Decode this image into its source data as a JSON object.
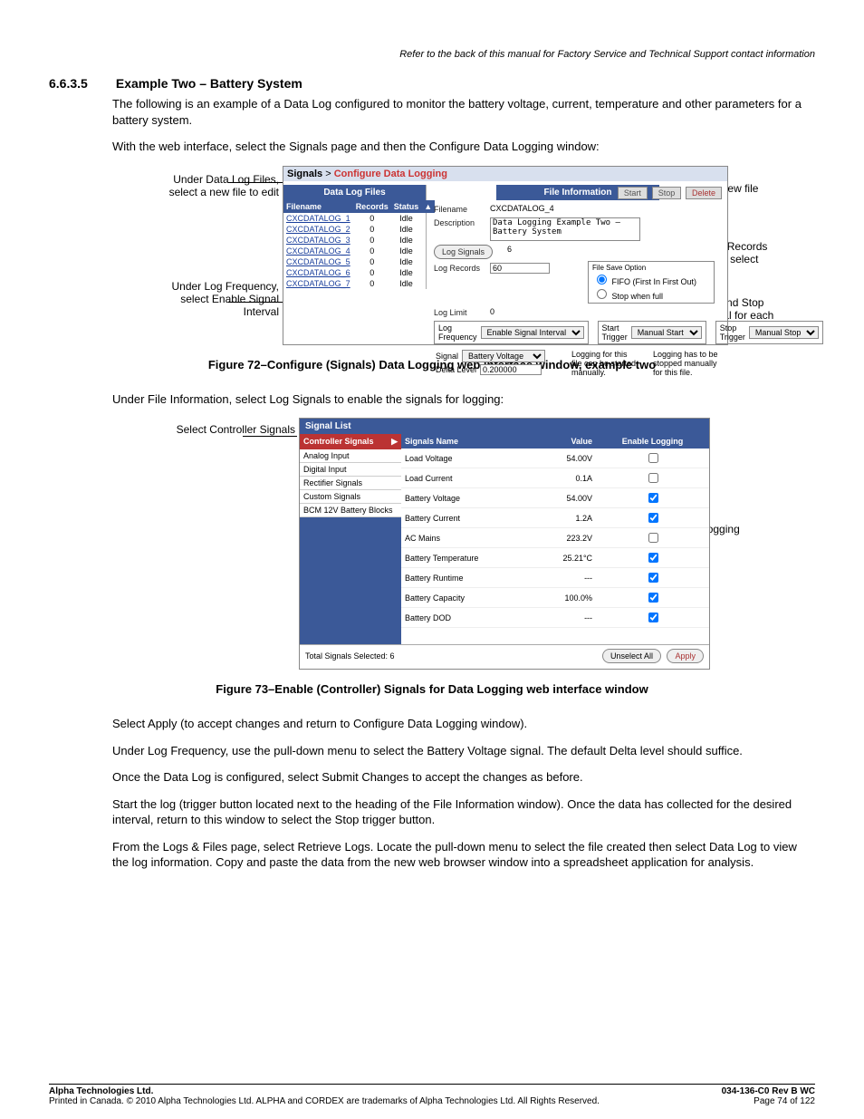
{
  "top_note": "Refer to the back of this manual for Factory Service and Technical Support contact information",
  "section": {
    "num": "6.6.3.5",
    "title": "Example Two – Battery System"
  },
  "intro1": "The following is an example of a Data Log configured to monitor the battery voltage, current, temperature and other parameters for a battery system.",
  "intro2": "With the web interface, select the Signals page and then the Configure Data Logging window:",
  "fig72": {
    "left1": "Under Data Log Files, select a new file to edit",
    "left2": "Under Log Frequency, select Enable Signal Interval",
    "right1": "Enter description of new file",
    "right2": "Enter number of Log Records you wish to keep and select FIFO",
    "right3": "Under Start Trigger and Stop Trigger, select Manual for each",
    "breadcrumb_a": "Signals",
    "breadcrumb_sep": ">",
    "breadcrumb_b": "Configure Data Logging",
    "dlf_title": "Data Log Files",
    "dlf_cols": {
      "c1": "Filename",
      "c2": "Records",
      "c3": "Status"
    },
    "dlf_rows": [
      {
        "f": "CXCDATALOG_1",
        "r": "0",
        "s": "Idle"
      },
      {
        "f": "CXCDATALOG_2",
        "r": "0",
        "s": "Idle"
      },
      {
        "f": "CXCDATALOG_3",
        "r": "0",
        "s": "Idle"
      },
      {
        "f": "CXCDATALOG_4",
        "r": "0",
        "s": "Idle"
      },
      {
        "f": "CXCDATALOG_5",
        "r": "0",
        "s": "Idle"
      },
      {
        "f": "CXCDATALOG_6",
        "r": "0",
        "s": "Idle"
      },
      {
        "f": "CXCDATALOG_7",
        "r": "0",
        "s": "Idle"
      }
    ],
    "fi_title": "File Information",
    "btn_start": "Start",
    "btn_stop": "Stop",
    "btn_delete": "Delete",
    "lab_filename": "Filename",
    "val_filename": "CXCDATALOG_4",
    "lab_desc": "Description",
    "val_desc": "Data Logging Example Two – Battery System",
    "btn_logsignals": "Log Signals",
    "val_logsignals": "6",
    "lab_logrecords": "Log Records",
    "val_logrecords": "60",
    "lab_loglimit": "Log Limit",
    "val_loglimit": "0",
    "fs_title": "File Save Option",
    "fs_opt1": "FIFO (First In First Out)",
    "fs_opt2": "Stop when full",
    "lf_title": "Log Frequency",
    "lf_val": "Enable Signal Interval",
    "st_title": "Start Trigger",
    "st_val": "Manual Start",
    "sp_title": "Stop Trigger",
    "sp_val": "Manual Stop",
    "note_start": "Logging for this file can be started manually.",
    "note_stop": "Logging has to be stopped manually for this file.",
    "sig_label": "Signal",
    "sig_val": "Battery Voltage",
    "delta_label": "Delta Level",
    "delta_val": "0.200000"
  },
  "figcap72": "Figure 72–Configure (Signals) Data Logging web interface window, example two",
  "mid1": "Under File Information, select Log Signals to enable the signals for logging:",
  "fig73": {
    "left1": "Select Controller Signals",
    "right1": "Toggle items for logging",
    "title": "Signal List",
    "side_hdr": "Controller Signals",
    "side_items": [
      "Analog Input",
      "Digital Input",
      "Rectifier Signals",
      "Custom Signals",
      "BCM 12V Battery Blocks"
    ],
    "cols": {
      "c1": "Signals Name",
      "c2": "Value",
      "c3": "Enable Logging"
    },
    "rows": [
      {
        "n": "Load Voltage",
        "v": "54.00V",
        "e": false
      },
      {
        "n": "Load Current",
        "v": "0.1A",
        "e": false
      },
      {
        "n": "Battery Voltage",
        "v": "54.00V",
        "e": true
      },
      {
        "n": "Battery Current",
        "v": "1.2A",
        "e": true
      },
      {
        "n": "AC Mains",
        "v": "223.2V",
        "e": false
      },
      {
        "n": "Battery Temperature",
        "v": "25.21°C",
        "e": true
      },
      {
        "n": "Battery Runtime",
        "v": "---",
        "e": true
      },
      {
        "n": "Battery Capacity",
        "v": "100.0%",
        "e": true
      },
      {
        "n": "Battery DOD",
        "v": "---",
        "e": true
      }
    ],
    "footer_total": "Total Signals Selected: 6",
    "btn_unselect": "Unselect All",
    "btn_apply": "Apply"
  },
  "figcap73": "Figure 73–Enable (Controller) Signals for Data Logging web interface window",
  "p_apply": "Select Apply (to accept changes and return to Configure Data Logging window).",
  "p_logfreq": "Under Log Frequency, use the pull-down menu to select the Battery Voltage signal. The default Delta level should suffice.",
  "p_submit": "Once the Data Log is configured, select Submit Changes to accept the changes as before.",
  "p_start": "Start the log (trigger button located next to the heading of the File Information window). Once the data has collected for the desired interval, return to this window to select the Stop trigger button.",
  "p_retrieve": "From the Logs & Files page, select Retrieve Logs. Locate the pull-down menu to select the file created then select Data Log to view the log information. Copy and paste the data from the new web browser window into a spreadsheet application for analysis.",
  "footer": {
    "co": "Alpha Technologies Ltd.",
    "line": "Printed in Canada.  © 2010 Alpha Technologies Ltd.  ALPHA and CORDEX are trademarks of Alpha Technologies Ltd.  All Rights Reserved.",
    "doc": "034-136-C0  Rev B  WC",
    "page": "Page 74 of 122"
  }
}
